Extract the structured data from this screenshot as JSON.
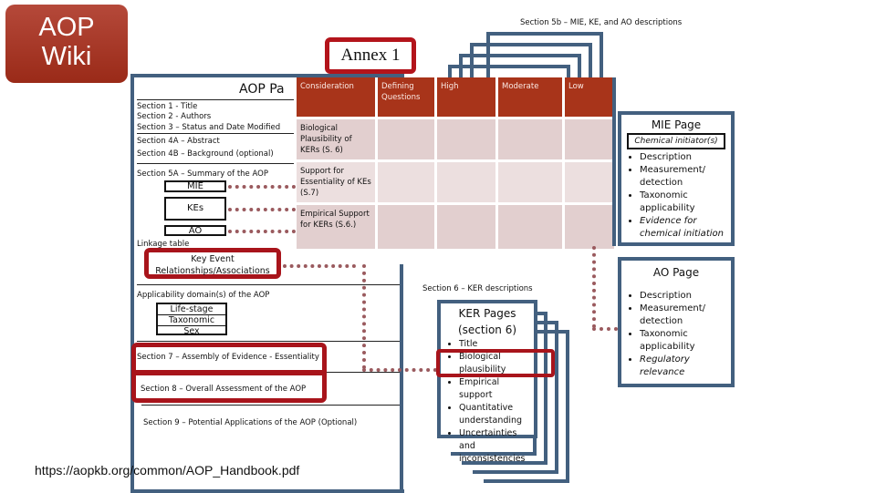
{
  "logo": {
    "line1": "AOP",
    "line2": "Wiki"
  },
  "annex_label": "Annex 1",
  "section5b_label": "Section 5b – MIE, KE, and AO descriptions",
  "aop_page": {
    "title": "AOP Pa",
    "sections_top": [
      "Section 1 - Title",
      "Section 2 - Authors",
      "Section 3 – Status and Date Modified"
    ],
    "sections_4": [
      "Section 4A – Abstract",
      "Section 4B – Background (optional)"
    ],
    "section5a": "Section 5A – Summary of the AOP",
    "mie": "MIE",
    "kes": "KEs",
    "ao": "AO",
    "linkage": "Linkage table",
    "ker_box": [
      "Key Event",
      "Relationships/Associations"
    ],
    "applicability": "Applicability domain(s) of the AOP",
    "domains": [
      "Life-stage",
      "Taxonomic",
      "Sex"
    ],
    "section7": "Section 7 – Assembly of Evidence - Essentiality",
    "section8": "Section 8 – Overall Assessment of the AOP",
    "section9": "Section 9 – Potential Applications of the AOP (Optional)"
  },
  "consideration_table": {
    "headers": [
      "Consideration",
      "Defining Questions",
      "High",
      "Moderate",
      "Low"
    ],
    "rows": [
      [
        "Biological Plausibility of KERs (S. 6)",
        "",
        "",
        "",
        ""
      ],
      [
        "Support for Essentiality of KEs (S.7)",
        "",
        "",
        "",
        ""
      ],
      [
        "Empirical Support for KERs (S.6.)",
        "",
        "",
        "",
        ""
      ]
    ]
  },
  "mie_page": {
    "title": "MIE Page",
    "subtitle": "Chemical initiator(s)",
    "items": [
      "Description",
      "Measurement/ detection",
      "Taxonomic applicability",
      "Evidence for chemical initiation"
    ]
  },
  "ao_page": {
    "title": "AO Page",
    "items": [
      "Description",
      "Measurement/ detection",
      "Taxonomic applicability",
      "Regulatory relevance"
    ]
  },
  "ker_section_label": "Section 6 – KER descriptions",
  "ker_page": {
    "title": "KER Pages",
    "subtitle": "(section 6)",
    "items": [
      "Title",
      "Biological plausibility",
      "Empirical support",
      "Quantitative understanding",
      "Uncertainties and inconsistencies"
    ]
  },
  "url": "https://aopkb.org/common/AOP_Handbook.pdf",
  "colors": {
    "accent_red": "#a8141b",
    "table_header": "#a8341a",
    "page_border": "#43607f"
  }
}
